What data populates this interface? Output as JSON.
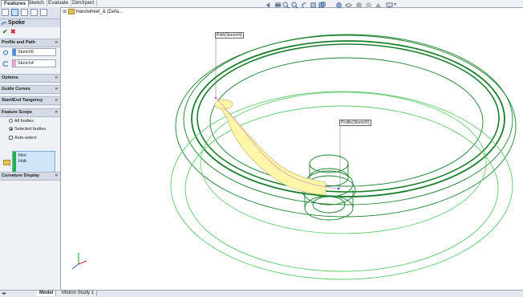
{
  "top_tabs": [
    "Features",
    "Sketch",
    "Evaluate",
    "DimXpert"
  ],
  "property_manager": {
    "title": "Spoke",
    "groups": {
      "profile_and_path": "Profile and Path",
      "options": "Options",
      "guide_curves": "Guide Curves",
      "start_end_tangency": "Start/End Tangency",
      "feature_scope": "Feature Scope",
      "curvature_display": "Curvature Display"
    },
    "profile_field": "Sketch5",
    "path_field": "Sketch4",
    "scope_options": {
      "all_bodies": "All bodies",
      "selected_bodies": "Selected bodies",
      "auto_select": "Auto-select"
    },
    "selected_bodies": [
      "Rim",
      "Hub"
    ]
  },
  "tree": {
    "part_name": "Handwheel_& (Defa..."
  },
  "callouts": {
    "path": "Path(Sketch4)",
    "profile": "Profile(Sketch5)"
  },
  "bottom_tabs": [
    "Model",
    "Motion Study 1"
  ],
  "colors": {
    "rim_green": "#1a7f2c",
    "sweep_yellow": "#fff7a8",
    "path_pink": "#d957c5",
    "profile_bar_blue": "#4a90e2",
    "path_bar_pink": "#f4a6d7",
    "bodies_bar_green": "#22b14c"
  }
}
